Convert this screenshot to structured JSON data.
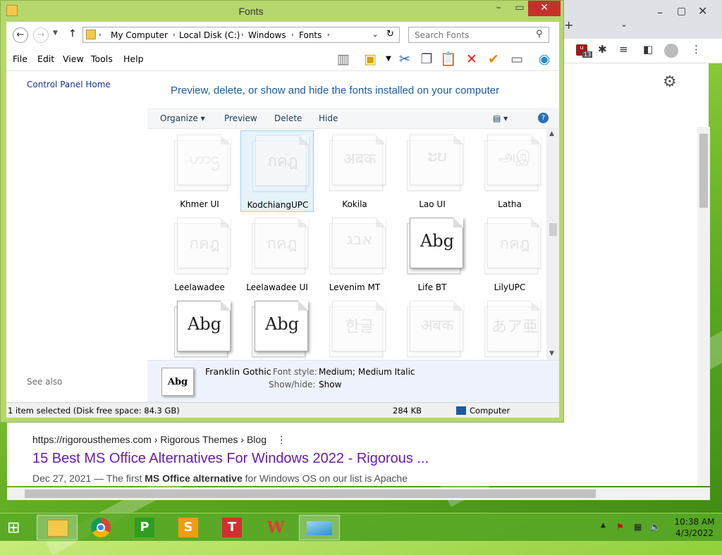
{
  "explorer": {
    "title": "Fonts",
    "breadcrumb": [
      "My Computer",
      "Local Disk (C:)",
      "Windows",
      "Fonts"
    ],
    "search_placeholder": "Search Fonts",
    "menu": [
      "File",
      "Edit",
      "View",
      "Tools",
      "Help"
    ],
    "left_pane": {
      "home_link": "Control Panel Home",
      "see_also": "See also"
    },
    "heading": "Preview, delete, or show and hide the fonts installed on your computer",
    "commands": [
      "Organize ▾",
      "Preview",
      "Delete",
      "Hide"
    ],
    "fonts": [
      {
        "name": "Khmer UI",
        "sample": "ဟာဌ",
        "style": "faded"
      },
      {
        "name": "KodchiangUPC",
        "sample": "กคฎ",
        "style": "faded",
        "selected": true
      },
      {
        "name": "Kokila",
        "sample": "अबक",
        "style": "faded"
      },
      {
        "name": "Lao UI",
        "sample": "ະບ",
        "style": "faded"
      },
      {
        "name": "Latha",
        "sample": "அஇ",
        "style": "faded"
      },
      {
        "name": "Leelawadee",
        "sample": "กคฎ",
        "style": "faded"
      },
      {
        "name": "Leelawadee UI",
        "sample": "กคฎ",
        "style": "faded"
      },
      {
        "name": "Levenim MT",
        "sample": "אבג",
        "style": "faded"
      },
      {
        "name": "Life BT",
        "sample": "Abg",
        "style": "dark"
      },
      {
        "name": "LilyUPC",
        "sample": "กคฎ",
        "style": "faded"
      },
      {
        "name": "",
        "sample": "Abg",
        "style": "dark"
      },
      {
        "name": "",
        "sample": "Abg",
        "style": "dark"
      },
      {
        "name": "",
        "sample": "한글",
        "style": "faded"
      },
      {
        "name": "",
        "sample": "अबक",
        "style": "faded"
      },
      {
        "name": "",
        "sample": "あア亜",
        "style": "faded"
      }
    ],
    "details": {
      "font_name": "Franklin Gothic",
      "thumb_sample": "Abg",
      "style_label": "Font style:",
      "style_value": "Medium; Medium Italic",
      "showhide_label": "Show/hide:",
      "showhide_value": "Show"
    },
    "status": {
      "selected": "1 item selected (Disk free space: 84.3 GB)",
      "size": "284 KB",
      "location": "Computer"
    }
  },
  "browser": {
    "result_url": "https://rigorousthemes.com › Rigorous Themes › Blog",
    "result_title": "15 Best MS Office Alternatives For Windows 2022 - Rigorous ...",
    "snippet_date": "Dec 27, 2021 — The first ",
    "snippet_bold": "MS Office alternative",
    "snippet_rest": " for Windows OS on our list is Apache",
    "extension_badge": "13"
  },
  "taskbar": {
    "apps": [
      "Start",
      "File Explorer",
      "Chrome",
      "WPS Presentation",
      "WPS Spreadsheets",
      "WPS Writer",
      "WPS Office",
      "Active window"
    ],
    "time": "10:38 AM",
    "date": "4/3/2022"
  },
  "colors": {
    "accent": "#8fcf3a",
    "link": "#681da8",
    "close": "#c7302a"
  }
}
